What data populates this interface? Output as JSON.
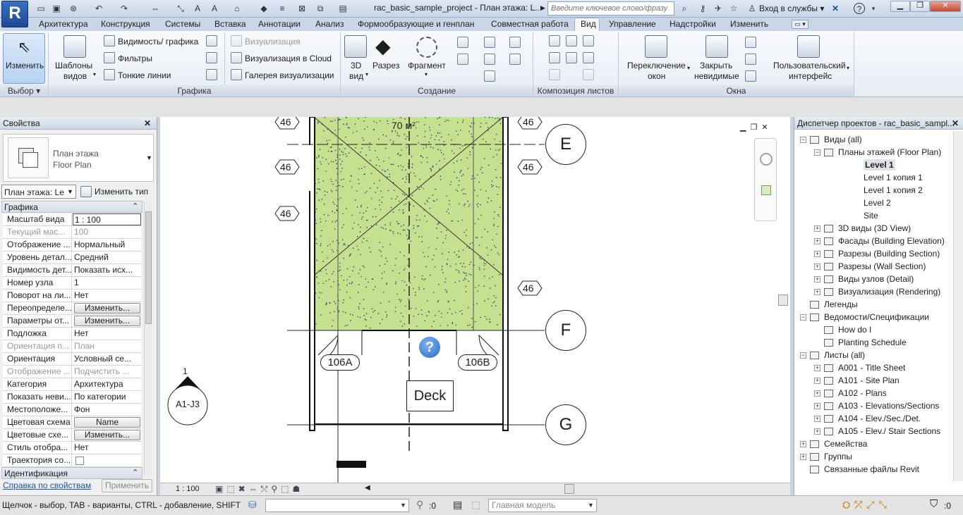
{
  "app": {
    "logo": "R",
    "doc_title": "rac_basic_sample_project - План этажа: L...",
    "search_placeholder": "Введите ключевое слово/фразу",
    "signin": "Вход в службы",
    "accent": "#1c4a95"
  },
  "ribbon_tabs": [
    "Архитектура",
    "Конструкция",
    "Системы",
    "Вставка",
    "Аннотации",
    "Анализ",
    "Формообразующие и генплан",
    "Совместная работа",
    "Вид",
    "Управление",
    "Надстройки",
    "Изменить"
  ],
  "active_tab": "Вид",
  "ribbon": {
    "modify": "Изменить",
    "templates": [
      "Шаблоны",
      "видов"
    ],
    "graphics": {
      "visibility": "Видимость/ графика",
      "filters": "Фильтры",
      "thin_lines": "Тонкие линии"
    },
    "render": {
      "viz": "Визуализация",
      "viz_cloud": "Визуализация  в Cloud",
      "gallery": "Галерея  визуализации"
    },
    "create": {
      "view3d": [
        "3D",
        "вид"
      ],
      "section": "Разрез",
      "fragment": "Фрагмент"
    },
    "windows": {
      "switch": [
        "Переключение",
        "окон"
      ],
      "close_hidden": [
        "Закрыть",
        "невидимые"
      ],
      "ui": [
        "Пользовательский",
        "интерфейс"
      ]
    },
    "panels": {
      "select": "Выбор",
      "graphics": "Графика",
      "create": "Создание",
      "sheet": "Композиция листов",
      "windows": "Окна"
    }
  },
  "properties": {
    "title": "Свойства",
    "type_name": "План этажа",
    "type_sub": "Floor Plan",
    "selector": "План этажа: Le",
    "edit_type": "Изменить тип",
    "group_graphics": "Графика",
    "rows": [
      {
        "k": "Масштаб вида",
        "v": "1 : 100",
        "type": "input"
      },
      {
        "k": "Текущий мас...",
        "v": "100",
        "type": "grey"
      },
      {
        "k": "Отображение ...",
        "v": "Нормальный"
      },
      {
        "k": "Уровень детал...",
        "v": "Средний"
      },
      {
        "k": "Видимость дет...",
        "v": "Показать исх..."
      },
      {
        "k": "Номер узла",
        "v": "1"
      },
      {
        "k": "Поворот на ли...",
        "v": "Нет"
      },
      {
        "k": "Переопределе...",
        "v": "Изменить...",
        "type": "btn"
      },
      {
        "k": "Параметры от...",
        "v": "Изменить...",
        "type": "btn"
      },
      {
        "k": "Подложка",
        "v": "Нет"
      },
      {
        "k": "Ориентация п...",
        "v": "План",
        "type": "grey"
      },
      {
        "k": "Ориентация",
        "v": "Условный се..."
      },
      {
        "k": "Отображение ...",
        "v": "Подчистить ...",
        "type": "grey"
      },
      {
        "k": "Категория",
        "v": "Архитектура"
      },
      {
        "k": "Показать неви...",
        "v": "По категории"
      },
      {
        "k": "Местоположе...",
        "v": "Фон"
      },
      {
        "k": "Цветовая схема",
        "v": "Name",
        "type": "btn"
      },
      {
        "k": "Цветовые схе...",
        "v": "Изменить...",
        "type": "btn"
      },
      {
        "k": "Стиль отобра...",
        "v": "Нет"
      },
      {
        "k": "Траектория со...",
        "v": "",
        "type": "check"
      }
    ],
    "group_ident": "Идентификация",
    "help_link": "Справка по свойствам",
    "apply": "Применить"
  },
  "canvas": {
    "area_label": "70 м²",
    "tags": [
      "46",
      "46",
      "46",
      "46",
      "46",
      "46"
    ],
    "grids": [
      "E",
      "F",
      "G"
    ],
    "doors": [
      "106A",
      "106B"
    ],
    "room": "Deck",
    "section_num": "1",
    "section_ref": "A1-J3",
    "room_color": "#c5e08f",
    "scale": "1 : 100"
  },
  "browser": {
    "title": "Диспетчер проектов - rac_basic_sampl...",
    "nodes": [
      {
        "t": "Виды (all)",
        "lvl": 0,
        "exp": "-"
      },
      {
        "t": "Планы этажей (Floor Plan)",
        "lvl": 1,
        "exp": "-"
      },
      {
        "t": "Level 1",
        "lvl": 2,
        "bold": true
      },
      {
        "t": "Level 1 копия 1",
        "lvl": 2
      },
      {
        "t": "Level 1 копия 2",
        "lvl": 2
      },
      {
        "t": "Level 2",
        "lvl": 2
      },
      {
        "t": "Site",
        "lvl": 2
      },
      {
        "t": "3D виды (3D View)",
        "lvl": 1,
        "exp": "+"
      },
      {
        "t": "Фасады (Building Elevation)",
        "lvl": 1,
        "exp": "+"
      },
      {
        "t": "Разрезы (Building Section)",
        "lvl": 1,
        "exp": "+"
      },
      {
        "t": "Разрезы (Wall Section)",
        "lvl": 1,
        "exp": "+"
      },
      {
        "t": "Виды узлов (Detail)",
        "lvl": 1,
        "exp": "+"
      },
      {
        "t": "Визуализация (Rendering)",
        "lvl": 1,
        "exp": "+"
      },
      {
        "t": "Легенды",
        "lvl": 0
      },
      {
        "t": "Ведомости/Спецификации",
        "lvl": 0,
        "exp": "-"
      },
      {
        "t": "How do I",
        "lvl": 1
      },
      {
        "t": "Planting Schedule",
        "lvl": 1
      },
      {
        "t": "Листы (all)",
        "lvl": 0,
        "exp": "-"
      },
      {
        "t": "A001 - Title Sheet",
        "lvl": 1,
        "exp": "+"
      },
      {
        "t": "A101 - Site Plan",
        "lvl": 1,
        "exp": "+"
      },
      {
        "t": "A102 - Plans",
        "lvl": 1,
        "exp": "+"
      },
      {
        "t": "A103 - Elevations/Sections",
        "lvl": 1,
        "exp": "+"
      },
      {
        "t": "A104 - Elev./Sec./Det.",
        "lvl": 1,
        "exp": "+"
      },
      {
        "t": "A105 - Elev./ Stair Sections",
        "lvl": 1,
        "exp": "+"
      },
      {
        "t": "Семейства",
        "lvl": 0,
        "exp": "+"
      },
      {
        "t": "Группы",
        "lvl": 0,
        "exp": "+"
      },
      {
        "t": "Связанные файлы Revit",
        "lvl": 0
      }
    ]
  },
  "status": {
    "hint": "Щелчок - выбор, TAB - варианты, CTRL - добавление, SHIFT - с",
    "zero1": ":0",
    "model": "Главная модель",
    "zero2": ":0"
  }
}
